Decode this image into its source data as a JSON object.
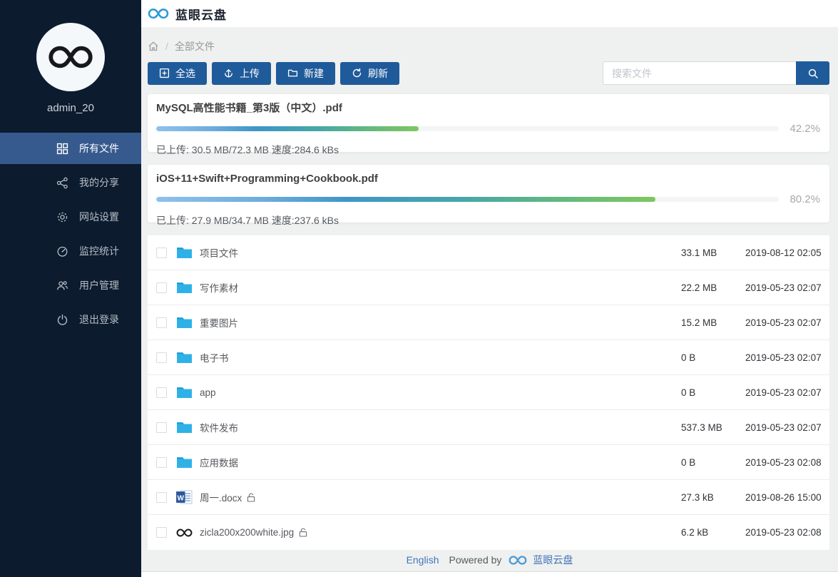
{
  "app": {
    "title": "蓝眼云盘"
  },
  "sidebar": {
    "username": "admin_20",
    "items": [
      {
        "label": "所有文件",
        "icon": "grid-icon",
        "active": true
      },
      {
        "label": "我的分享",
        "icon": "share-icon",
        "active": false
      },
      {
        "label": "网站设置",
        "icon": "gear-icon",
        "active": false
      },
      {
        "label": "监控统计",
        "icon": "gauge-icon",
        "active": false
      },
      {
        "label": "用户管理",
        "icon": "users-icon",
        "active": false
      },
      {
        "label": "退出登录",
        "icon": "power-icon",
        "active": false
      }
    ]
  },
  "breadcrumb": {
    "home_icon": "home-icon",
    "current": "全部文件"
  },
  "toolbar": {
    "select_all": "全选",
    "upload": "上传",
    "create": "新建",
    "refresh": "刷新"
  },
  "search": {
    "placeholder": "搜索文件",
    "icon": "search-icon"
  },
  "uploads": [
    {
      "name": "MySQL高性能书籍_第3版（中文）.pdf",
      "percent": "42.2%",
      "percent_value": 42.2,
      "status": "已上传: 30.5 MB/72.3 MB 速度:284.6 kBs"
    },
    {
      "name": "iOS+11+Swift+Programming+Cookbook.pdf",
      "percent": "80.2%",
      "percent_value": 80.2,
      "status": "已上传: 27.9 MB/34.7 MB 速度:237.6 kBs"
    }
  ],
  "files": [
    {
      "name": "项目文件",
      "icon": "folder-icon",
      "size": "33.1 MB",
      "date": "2019-08-12 02:05",
      "unlocked": false
    },
    {
      "name": "写作素材",
      "icon": "folder-icon",
      "size": "22.2 MB",
      "date": "2019-05-23 02:07",
      "unlocked": false
    },
    {
      "name": "重要图片",
      "icon": "folder-icon",
      "size": "15.2 MB",
      "date": "2019-05-23 02:07",
      "unlocked": false
    },
    {
      "name": "电子书",
      "icon": "folder-icon",
      "size": "0 B",
      "date": "2019-05-23 02:07",
      "unlocked": false
    },
    {
      "name": "app",
      "icon": "folder-icon",
      "size": "0 B",
      "date": "2019-05-23 02:07",
      "unlocked": false
    },
    {
      "name": "软件发布",
      "icon": "folder-icon",
      "size": "537.3 MB",
      "date": "2019-05-23 02:07",
      "unlocked": false
    },
    {
      "name": "应用数据",
      "icon": "folder-icon",
      "size": "0 B",
      "date": "2019-05-23 02:08",
      "unlocked": false
    },
    {
      "name": "周一.docx",
      "icon": "word-icon",
      "size": "27.3 kB",
      "date": "2019-08-26 15:00",
      "unlocked": true
    },
    {
      "name": "zicla200x200white.jpg",
      "icon": "image-icon",
      "size": "6.2 kB",
      "date": "2019-05-23 02:08",
      "unlocked": true
    }
  ],
  "footer": {
    "language": "English",
    "powered_by": "Powered by",
    "brand": "蓝眼云盘"
  },
  "colors": {
    "sidebar_bg": "#0c1b2e",
    "sidebar_active": "#375a8e",
    "button_blue": "#1f5b9a",
    "folder_blue": "#2fb1e8",
    "link_blue": "#4176b8",
    "progress_start": "#8fc1ec",
    "progress_end": "#7dc75f",
    "content_bg": "#eff0f0"
  }
}
